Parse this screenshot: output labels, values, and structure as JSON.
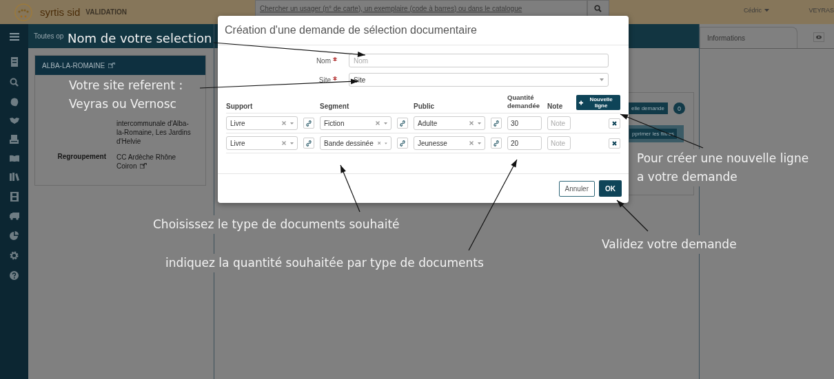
{
  "header": {
    "brand": "syrtis sid",
    "env": "VALIDATION",
    "search": {
      "placeholder": "Chercher un usager (n° de carte), un exemplaire (code à barres) ou dans le catalogue"
    },
    "user": "Cédric",
    "site": "VEYRAS"
  },
  "toolbar": {
    "breadcrumb": "Toutes op"
  },
  "site_card": {
    "title": "ALBA-LA-ROMAINE",
    "rows": [
      {
        "value": "intercommunale d'Alba-la-Romaine, Les Jardins d'Helvie",
        "external_link": false
      },
      {
        "label": "Regroupement",
        "value": "CC Ardèche Rhône Coiron",
        "external_link": true
      }
    ]
  },
  "middle_panel": {
    "request_button": "elle demande",
    "count": "0",
    "filter_button": "pprimer les filtres"
  },
  "right_panel": {
    "tab": "Informations"
  },
  "modal": {
    "title": "Création d'une demande de sélection documentaire",
    "fields": [
      {
        "label": "Nom",
        "required": true,
        "kind": "text",
        "placeholder": "Nom"
      },
      {
        "label": "Site",
        "required": true,
        "kind": "select",
        "value": "Site"
      }
    ],
    "columns": [
      "Support",
      "Segment",
      "Public",
      "Quantité demandée",
      "Note"
    ],
    "add_button": "Nouvelle ligne",
    "rows": [
      {
        "support": "Livre",
        "segment": "Fiction",
        "public": "Adulte",
        "quantity": "30",
        "note_placeholder": "Note"
      },
      {
        "support": "Livre",
        "segment": "Bande dessinée",
        "public": "Jeunesse",
        "quantity": "20",
        "note_placeholder": "Note"
      }
    ],
    "buttons": [
      {
        "label": "Annuler",
        "kind": "secondary"
      },
      {
        "label": "OK",
        "kind": "primary"
      }
    ]
  },
  "annotations": [
    {
      "lines": [
        "Nom de votre selection"
      ]
    },
    {
      "lines": [
        "Votre site referent :",
        "Veyras ou Vernosc"
      ]
    },
    {
      "lines": [
        "Choisissez le type de documents souhaité"
      ]
    },
    {
      "lines": [
        "indiquez la quantité souhaitée par type de documents"
      ]
    },
    {
      "lines": [
        "Validez votre demande"
      ]
    },
    {
      "lines": [
        "Pour créer une nouvelle ligne",
        "a votre demande"
      ]
    }
  ]
}
